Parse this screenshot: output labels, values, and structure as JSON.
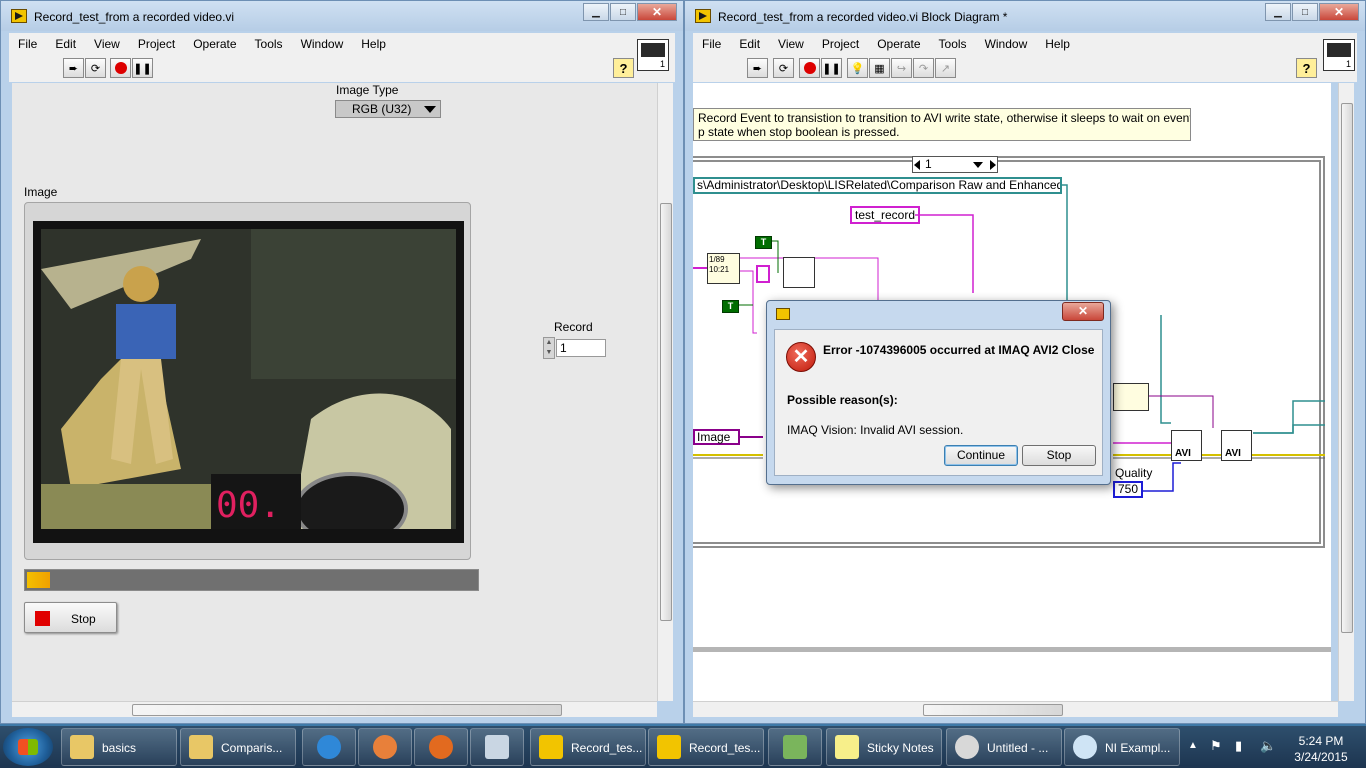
{
  "front_panel": {
    "title": "Record_test_from a recorded video.vi",
    "menu": [
      "File",
      "Edit",
      "View",
      "Project",
      "Operate",
      "Tools",
      "Window",
      "Help"
    ],
    "image_type_label": "Image Type",
    "image_type_value": "RGB (U32)",
    "image_label": "Image",
    "record_label": "Record",
    "record_value": "1",
    "progress_fraction": 0.05,
    "stop_label": "Stop",
    "help_label": "?"
  },
  "block_diagram": {
    "title": "Record_test_from a recorded video.vi Block Diagram *",
    "menu": [
      "File",
      "Edit",
      "View",
      "Project",
      "Operate",
      "Tools",
      "Window",
      "Help"
    ],
    "comment_line1": "Record Event to transistion to transition to AVI write state, otherwise it sleeps to wait on event",
    "comment_line2": "p state when stop boolean is pressed.",
    "case_selector": "1",
    "path_constant": "s\\Administrator\\Desktop\\LISRelated\\Comparison Raw and Enhanced",
    "string_constant": "test_record",
    "bool_true": "T",
    "image_ref": "Image",
    "quality_label": "Quality",
    "quality_value": "750",
    "avi_label": "AVI",
    "timestamp_1": "1/89",
    "timestamp_2": "10:21",
    "help_label": "?"
  },
  "dialog": {
    "error_title": "Error -1074396005 occurred at IMAQ AVI2 Close",
    "reason_label": "Possible reason(s):",
    "reason_detail": "IMAQ Vision:  Invalid AVI session.",
    "continue_label": "Continue",
    "stop_label": "Stop"
  },
  "taskbar": {
    "items": [
      {
        "label": "basics",
        "icon": "folder-icon"
      },
      {
        "label": "Comparis...",
        "icon": "folder-icon"
      },
      {
        "label": "",
        "icon": "ie-icon"
      },
      {
        "label": "",
        "icon": "media-player-icon"
      },
      {
        "label": "",
        "icon": "firefox-icon"
      },
      {
        "label": "",
        "icon": "calculator-icon"
      },
      {
        "label": "Record_tes...",
        "icon": "labview-icon"
      },
      {
        "label": "Record_tes...",
        "icon": "labview-icon"
      },
      {
        "label": "",
        "icon": "spreadsheet-icon"
      },
      {
        "label": "Sticky Notes",
        "icon": "sticky-notes-icon"
      },
      {
        "label": "Untitled - ...",
        "icon": "paint-icon"
      },
      {
        "label": "NI Exampl...",
        "icon": "ni-example-icon"
      }
    ],
    "time": "5:24 PM",
    "date": "3/24/2015"
  }
}
